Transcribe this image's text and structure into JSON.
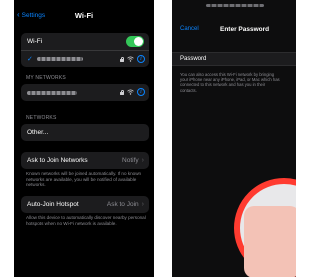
{
  "left_screen": {
    "nav": {
      "back_label": "Settings",
      "title": "Wi-Fi"
    },
    "wifi_toggle": {
      "label": "Wi-Fi",
      "on": true,
      "color": "#34c759"
    },
    "my_networks_label": "MY NETWORKS",
    "networks_label": "NETWORKS",
    "other_label": "Other...",
    "ask_to_join": {
      "label": "Ask to Join Networks",
      "value": "Notify",
      "footnote": "Known networks will be joined automatically. If no known networks are available, you will be notified of available networks."
    },
    "auto_join_hotspot": {
      "label": "Auto-Join Hotspot",
      "value": "Ask to Join",
      "footnote": "Allow this device to automatically discover nearby personal hotspots when no Wi-Fi network is available."
    }
  },
  "right_screen": {
    "cancel_label": "Cancel",
    "title": "Enter Password",
    "password_label": "Password",
    "help_text": [
      "You can also access this Wi-Fi network by bringing",
      "your iPhone near any iPhone, iPad, or Mac which has",
      "connected to this network and has you in their",
      "contacts."
    ],
    "share_art_colors": [
      "#ff3b30",
      "#f3c2b6"
    ]
  },
  "colors": {
    "accent": "#0a84ff",
    "background": "#000000",
    "cell": "#1c1c1e"
  }
}
